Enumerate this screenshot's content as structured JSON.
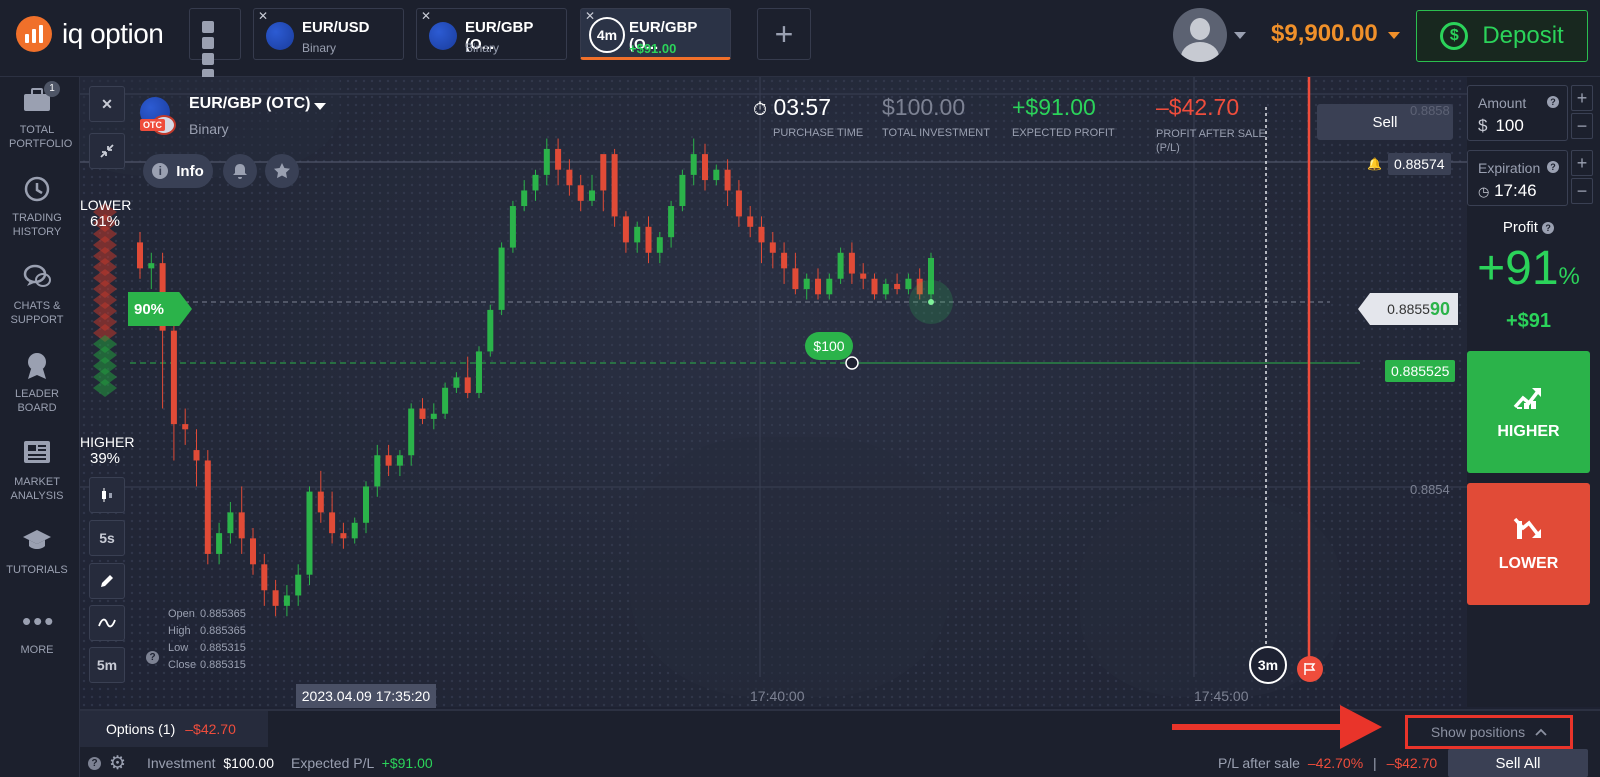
{
  "header": {
    "logo_text": "iq option",
    "tabs": [
      {
        "title": "EUR/USD",
        "subtitle": "Binary"
      },
      {
        "title": "EUR/GBP (O...",
        "subtitle": "Binary"
      },
      {
        "title": "EUR/GBP (O...",
        "subtitle": "+$91.00",
        "timer": "4m"
      }
    ],
    "balance": "$9,900.00",
    "deposit_label": "Deposit"
  },
  "sidebar": {
    "items": [
      {
        "label": "TOTAL PORTFOLIO",
        "badge": "1"
      },
      {
        "label": "TRADING HISTORY"
      },
      {
        "label": "CHATS & SUPPORT"
      },
      {
        "label": "LEADER BOARD"
      },
      {
        "label": "MARKET ANALYSIS"
      },
      {
        "label": "TUTORIALS"
      },
      {
        "label": "MORE"
      }
    ]
  },
  "chart_header": {
    "asset": "EUR/GBP (OTC)",
    "asset_type": "Binary",
    "otc_badge": "OTC",
    "info_label": "Info",
    "purchase_time": "03:57",
    "purchase_time_label": "PURCHASE TIME",
    "total_investment": "$100.00",
    "total_investment_label": "TOTAL INVESTMENT",
    "expected_profit": "+$91.00",
    "expected_profit_label": "EXPECTED PROFIT",
    "profit_after_sale": "–$42.70",
    "profit_after_sale_label": "PROFIT AFTER SALE (P/L)",
    "sell_label": "Sell"
  },
  "chart": {
    "lower_label": "LOWER",
    "lower_pct": "61%",
    "higher_label": "HIGHER",
    "higher_pct": "39%",
    "payout_tag": "90%",
    "position_tag": "$100",
    "price_alert": "0.88574",
    "price_current_main": "0.8855",
    "price_current_tail": "90",
    "price_entry": "0.885525",
    "y_tick_top": "0.8858",
    "y_tick_mid": "0.8854",
    "timeframes": [
      "5s",
      "5m"
    ],
    "ohlc": {
      "open_label": "Open",
      "open": "0.885365",
      "high_label": "High",
      "high": "0.885365",
      "low_label": "Low",
      "low": "0.885315",
      "close_label": "Close",
      "close": "0.885315"
    },
    "date_tag": "2023.04.09 17:35:20",
    "x_ticks": [
      "17:40:00",
      "17:45:00"
    ],
    "expiry_marker": "3m",
    "candles": [
      [
        0.88562,
        0.88564,
        0.88555,
        0.88557,
        "d"
      ],
      [
        0.88557,
        0.8856,
        0.88553,
        0.88558,
        "u"
      ],
      [
        0.88558,
        0.8856,
        0.8853,
        0.88545,
        "d"
      ],
      [
        0.88545,
        0.88548,
        0.8852,
        0.88527,
        "d"
      ],
      [
        0.88527,
        0.8853,
        0.88523,
        0.88526,
        "d"
      ],
      [
        0.88522,
        0.88526,
        0.88515,
        0.8852,
        "d"
      ],
      [
        0.8852,
        0.88522,
        0.885,
        0.88502,
        "d"
      ],
      [
        0.88502,
        0.88508,
        0.885,
        0.88506,
        "u"
      ],
      [
        0.88506,
        0.88512,
        0.88504,
        0.8851,
        "u"
      ],
      [
        0.8851,
        0.88515,
        0.88502,
        0.88505,
        "d"
      ],
      [
        0.88505,
        0.88507,
        0.88498,
        0.885,
        "d"
      ],
      [
        0.885,
        0.88502,
        0.88492,
        0.88495,
        "d"
      ],
      [
        0.88495,
        0.88497,
        0.8849,
        0.88492,
        "d"
      ],
      [
        0.88492,
        0.88496,
        0.8849,
        0.88494,
        "u"
      ],
      [
        0.88494,
        0.885,
        0.88492,
        0.88498,
        "u"
      ],
      [
        0.88498,
        0.88515,
        0.88496,
        0.88514,
        "u"
      ],
      [
        0.88514,
        0.88518,
        0.88508,
        0.8851,
        "d"
      ],
      [
        0.8851,
        0.88514,
        0.88504,
        0.88506,
        "d"
      ],
      [
        0.88506,
        0.88508,
        0.88503,
        0.88505,
        "d"
      ],
      [
        0.88505,
        0.88509,
        0.88504,
        0.88508,
        "u"
      ],
      [
        0.88508,
        0.88516,
        0.88506,
        0.88515,
        "u"
      ],
      [
        0.88515,
        0.88523,
        0.88513,
        0.88521,
        "u"
      ],
      [
        0.88521,
        0.88523,
        0.88517,
        0.88519,
        "d"
      ],
      [
        0.88519,
        0.88522,
        0.88517,
        0.88521,
        "u"
      ],
      [
        0.88521,
        0.88531,
        0.88519,
        0.8853,
        "u"
      ],
      [
        0.8853,
        0.88532,
        0.88527,
        0.88528,
        "d"
      ],
      [
        0.88528,
        0.88531,
        0.88526,
        0.88529,
        "u"
      ],
      [
        0.88529,
        0.88535,
        0.88528,
        0.88534,
        "u"
      ],
      [
        0.88534,
        0.88537,
        0.88533,
        0.88536,
        "u"
      ],
      [
        0.88536,
        0.8854,
        0.88532,
        0.88533,
        "d"
      ],
      [
        0.88533,
        0.88542,
        0.88532,
        0.88541,
        "u"
      ],
      [
        0.88541,
        0.8855,
        0.8854,
        0.88549,
        "u"
      ],
      [
        0.88549,
        0.88562,
        0.88548,
        0.88561,
        "u"
      ],
      [
        0.88561,
        0.8857,
        0.8856,
        0.88569,
        "u"
      ],
      [
        0.88569,
        0.88574,
        0.88568,
        0.88572,
        "u"
      ],
      [
        0.88572,
        0.88576,
        0.8857,
        0.88575,
        "u"
      ],
      [
        0.88575,
        0.88582,
        0.88573,
        0.8858,
        "u"
      ],
      [
        0.8858,
        0.88582,
        0.88573,
        0.88576,
        "d"
      ],
      [
        0.88576,
        0.88578,
        0.88571,
        0.88573,
        "d"
      ],
      [
        0.88573,
        0.88575,
        0.88568,
        0.8857,
        "d"
      ],
      [
        0.8857,
        0.88575,
        0.88569,
        0.88572,
        "u"
      ],
      [
        0.88572,
        0.88576,
        0.88568,
        0.88579,
        "d"
      ],
      [
        0.88579,
        0.8858,
        0.88565,
        0.88567,
        "d"
      ],
      [
        0.88567,
        0.88568,
        0.8856,
        0.88562,
        "d"
      ],
      [
        0.88562,
        0.88566,
        0.8856,
        0.88565,
        "u"
      ],
      [
        0.88565,
        0.88567,
        0.88558,
        0.8856,
        "d"
      ],
      [
        0.8856,
        0.88564,
        0.88558,
        0.88563,
        "u"
      ],
      [
        0.88563,
        0.8857,
        0.88561,
        0.88569,
        "u"
      ],
      [
        0.88569,
        0.88576,
        0.88568,
        0.88575,
        "u"
      ],
      [
        0.88575,
        0.88582,
        0.88573,
        0.88579,
        "u"
      ],
      [
        0.88579,
        0.88581,
        0.88572,
        0.88574,
        "d"
      ],
      [
        0.88574,
        0.88577,
        0.88573,
        0.88576,
        "u"
      ],
      [
        0.88576,
        0.88578,
        0.88569,
        0.88572,
        "d"
      ],
      [
        0.88572,
        0.88574,
        0.88565,
        0.88567,
        "d"
      ],
      [
        0.88567,
        0.88569,
        0.88563,
        0.88565,
        "d"
      ],
      [
        0.88565,
        0.88567,
        0.88558,
        0.88562,
        "d"
      ],
      [
        0.88562,
        0.88564,
        0.88557,
        0.8856,
        "d"
      ],
      [
        0.8856,
        0.88562,
        0.88554,
        0.88557,
        "d"
      ],
      [
        0.88557,
        0.8856,
        0.88552,
        0.88553,
        "d"
      ],
      [
        0.88553,
        0.88556,
        0.88551,
        0.88555,
        "u"
      ],
      [
        0.88555,
        0.88557,
        0.88551,
        0.88552,
        "d"
      ],
      [
        0.88552,
        0.88556,
        0.88551,
        0.88555,
        "u"
      ],
      [
        0.88555,
        0.88561,
        0.88554,
        0.8856,
        "u"
      ],
      [
        0.8856,
        0.88562,
        0.88554,
        0.88556,
        "d"
      ],
      [
        0.88556,
        0.88558,
        0.88553,
        0.88555,
        "d"
      ],
      [
        0.88555,
        0.88556,
        0.88551,
        0.88552,
        "d"
      ],
      [
        0.88552,
        0.88555,
        0.88551,
        0.88554,
        "u"
      ],
      [
        0.88554,
        0.88556,
        0.88552,
        0.88553,
        "d"
      ],
      [
        0.88553,
        0.88556,
        0.88552,
        0.88555,
        "u"
      ],
      [
        0.88555,
        0.88557,
        0.88551,
        0.88552,
        "d"
      ],
      [
        0.88552,
        0.8856,
        0.88551,
        0.88559,
        "u"
      ]
    ]
  },
  "right_panel": {
    "amount_label": "Amount",
    "amount_currency": "$",
    "amount_value": "100",
    "expiration_label": "Expiration",
    "expiration_value": "17:46",
    "profit_label": "Profit",
    "profit_pct": "+91",
    "profit_pct_sign": "%",
    "profit_amount": "+$91",
    "higher_label": "HIGHER",
    "lower_label": "LOWER"
  },
  "bottom": {
    "options_label": "Options",
    "options_count": "(1)",
    "options_pl": "–$42.70",
    "show_positions": "Show positions",
    "investment_label": "Investment",
    "investment_value": "$100.00",
    "expected_label": "Expected P/L",
    "expected_value": "+$91.00",
    "pl_after_label": "P/L after sale",
    "pl_after_pct": "–42.70%",
    "pl_after_sep": "|",
    "pl_after_value": "–$42.70",
    "sell_all": "Sell All"
  },
  "colors": {
    "accent": "#f0702a",
    "green": "#2bd35a",
    "red": "#ef4d3c",
    "balance": "#f0902a"
  }
}
